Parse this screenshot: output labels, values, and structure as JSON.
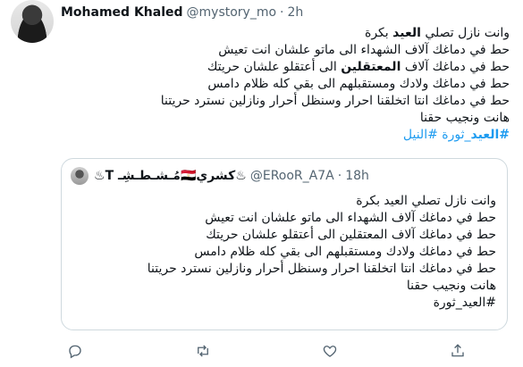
{
  "tweet": {
    "author_name": "Mohamed Khaled",
    "handle": "@mystory_mo",
    "separator": "·",
    "time": "2h",
    "lines": [
      {
        "pre": "وانت نازل تصلي ",
        "bold": "العيد",
        "post": " بكرة"
      },
      {
        "pre": "حط في دماغك آلاف الشهداء الى ماتو علشان انت تعيش",
        "bold": "",
        "post": ""
      },
      {
        "pre": "حط في دماغك آلاف ",
        "bold": "المعتقلين",
        "post": " الى أعتقلو علشان حريتك"
      },
      {
        "pre": "حط في دماغك ولادك ومستقبلهم الى بقي كله ظلام دامس",
        "bold": "",
        "post": ""
      },
      {
        "pre": "حط في دماغك انتا اتخلقنا احرار وسنظل أحرار ونازلين نسترد حريتنا",
        "bold": "",
        "post": ""
      },
      {
        "pre": "هانت ونجيب حقنا",
        "bold": "",
        "post": ""
      }
    ],
    "hashtags": {
      "first_bold": "#العيد",
      "first_rest": "_ثورة",
      "second": "#النيل"
    }
  },
  "quote": {
    "display_name": "♨كشري🇪🇬مُـشـطـشِـ T♨",
    "handle": "@ERooR_A7A",
    "separator": "·",
    "time": "18h",
    "lines": [
      "وانت نازل تصلي العيد بكرة",
      "حط في دماغك آلاف الشهداء الى ماتو علشان انت تعيش",
      "حط في دماغك آلاف المعتقلين الى أعتقلو علشان حريتك",
      "حط في دماغك ولادك ومستقبلهم الى بقي كله ظلام دامس",
      "حط في دماغك انتا اتخلقنا احرار وسنظل أحرار ونازلين نسترد حريتنا",
      "هانت ونجيب حقنا",
      "#العيد_ثورة"
    ]
  },
  "actions": [
    {
      "icon": "reply-icon"
    },
    {
      "icon": "retweet-icon"
    },
    {
      "icon": "like-icon"
    },
    {
      "icon": "share-icon"
    }
  ]
}
